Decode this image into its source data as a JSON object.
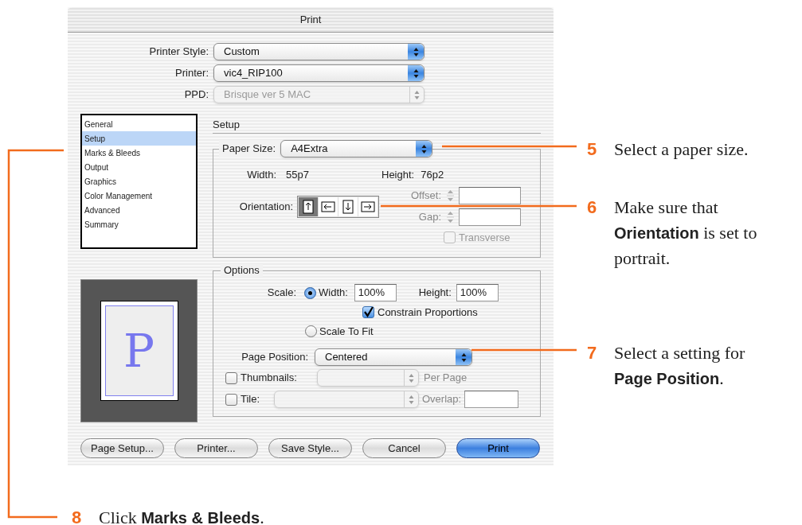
{
  "window": {
    "title": "Print"
  },
  "top_fields": [
    {
      "label": "Printer Style:",
      "value": "Custom",
      "disabled": false
    },
    {
      "label": "Printer:",
      "value": "vic4_RIP100",
      "disabled": false
    },
    {
      "label": "PPD:",
      "value": "Brisque ver 5 MAC",
      "disabled": true
    }
  ],
  "sidebar": {
    "items": [
      {
        "label": "General",
        "selected": false
      },
      {
        "label": "Setup",
        "selected": true
      },
      {
        "label": "Marks & Bleeds",
        "selected": false
      },
      {
        "label": "Output",
        "selected": false
      },
      {
        "label": "Graphics",
        "selected": false
      },
      {
        "label": "Color Management",
        "selected": false
      },
      {
        "label": "Advanced",
        "selected": false
      },
      {
        "label": "Summary",
        "selected": false
      }
    ]
  },
  "preview": {
    "letter": "P"
  },
  "section_title": "Setup",
  "paper": {
    "label": "Paper Size:",
    "value": "A4Extra",
    "width_label": "Width:",
    "width_value": "55p7",
    "height_label": "Height:",
    "height_value": "76p2",
    "orientation_label": "Orientation:",
    "orientations": [
      {
        "kind": "portrait",
        "selected": true
      },
      {
        "kind": "landscape",
        "selected": false
      },
      {
        "kind": "portrait-reversed",
        "selected": false
      },
      {
        "kind": "landscape-reversed",
        "selected": false
      }
    ],
    "offset_label": "Offset:",
    "gap_label": "Gap:",
    "transverse": {
      "label": "Transverse",
      "checked": false,
      "disabled": true
    }
  },
  "options": {
    "title": "Options",
    "scale_label": "Scale:",
    "width_radio": {
      "label": "Width:",
      "selected": true
    },
    "width_value": "100%",
    "height_label": "Height:",
    "height_value": "100%",
    "constrain": {
      "label": "Constrain Proportions",
      "checked": true
    },
    "scale_to_fit": {
      "label": "Scale To Fit",
      "selected": false
    },
    "page_position": {
      "label": "Page Position:",
      "value": "Centered"
    },
    "thumbnails": {
      "label": "Thumbnails:",
      "checked": false,
      "suffix": "Per Page"
    },
    "tile": {
      "label": "Tile:",
      "checked": false,
      "overlap_label": "Overlap:"
    }
  },
  "buttons": [
    {
      "label": "Page Setup...",
      "default": false
    },
    {
      "label": "Printer...",
      "default": false
    },
    {
      "label": "Save Style...",
      "default": false
    },
    {
      "label": "Cancel",
      "default": false
    },
    {
      "label": "Print",
      "default": true
    }
  ],
  "callouts": [
    {
      "number": "5",
      "text": "Select a paper size."
    },
    {
      "number": "6",
      "text": "Make sure that **Orientation** is set to portrait."
    },
    {
      "number": "7",
      "text": "Select a setting for  **Page Position**."
    },
    {
      "number": "8",
      "text": "Click **Marks & Bleeds**."
    }
  ]
}
